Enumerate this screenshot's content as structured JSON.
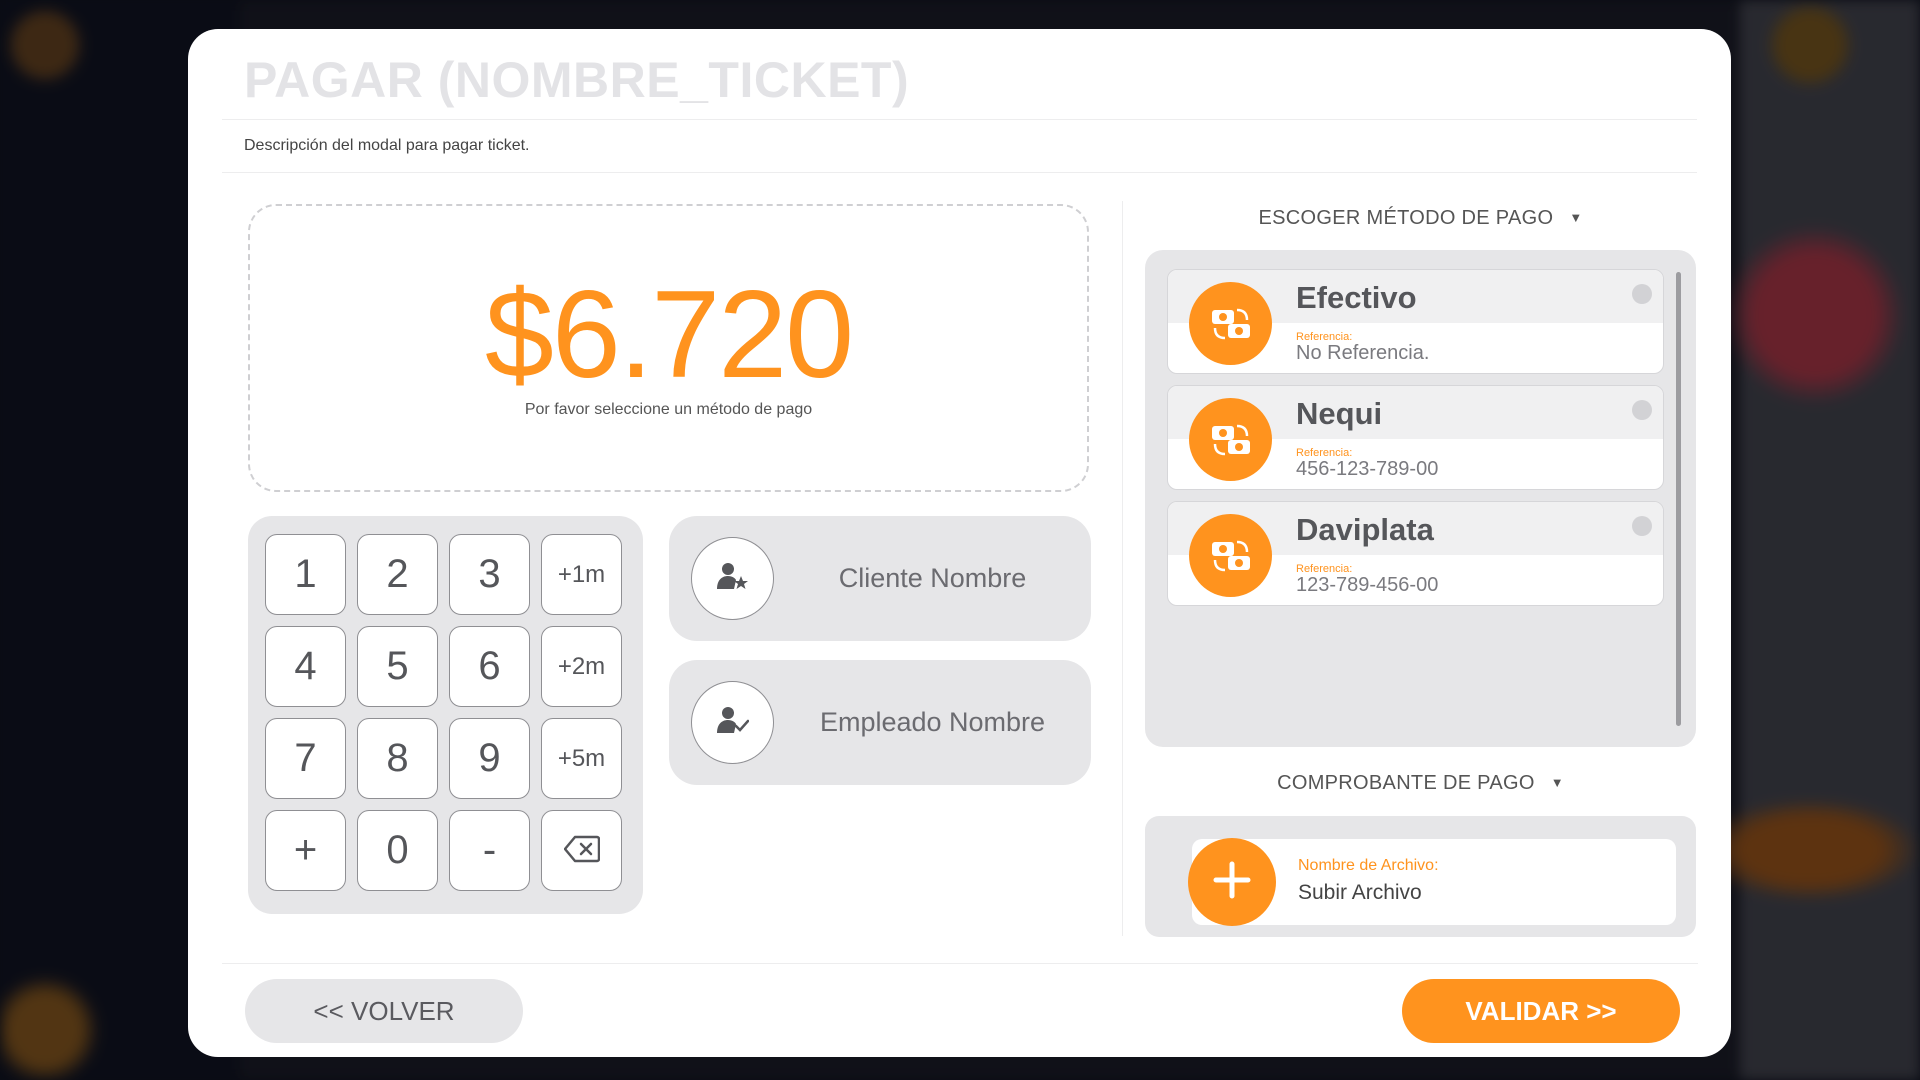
{
  "modal": {
    "title": "PAGAR (NOMBRE_TICKET)",
    "description": "Descripción del modal para pagar ticket."
  },
  "amount": {
    "value": "$6.720",
    "hint": "Por favor seleccione un método de pago"
  },
  "keypad": {
    "keys": [
      "1",
      "2",
      "3",
      "+1m",
      "4",
      "5",
      "6",
      "+2m",
      "7",
      "8",
      "9",
      "+5m",
      "+",
      "0",
      "-",
      "backspace"
    ]
  },
  "people": {
    "client": "Cliente Nombre",
    "employee": "Empleado Nombre"
  },
  "payment": {
    "section_label": "ESCOGER MÉTODO DE PAGO",
    "methods": [
      {
        "name": "Efectivo",
        "ref_label": "Referencia:",
        "ref_value": "No Referencia."
      },
      {
        "name": "Nequi",
        "ref_label": "Referencia:",
        "ref_value": "456-123-789-00"
      },
      {
        "name": "Daviplata",
        "ref_label": "Referencia:",
        "ref_value": "123-789-456-00"
      }
    ]
  },
  "receipt": {
    "section_label": "COMPROBANTE DE PAGO",
    "file_label": "Nombre de Archivo:",
    "file_value": "Subir Archivo"
  },
  "actions": {
    "back": "<< VOLVER",
    "validate": "VALIDAR >>"
  },
  "colors": {
    "accent": "#ff931e",
    "panel": "#e6e6e8",
    "title": "#e3e3e6"
  },
  "icons": {
    "method": "money-exchange-icon",
    "client": "user-star-icon",
    "employee": "user-check-icon",
    "upload": "plus-icon",
    "caret": "caret-down-icon",
    "backspace": "backspace-icon"
  }
}
